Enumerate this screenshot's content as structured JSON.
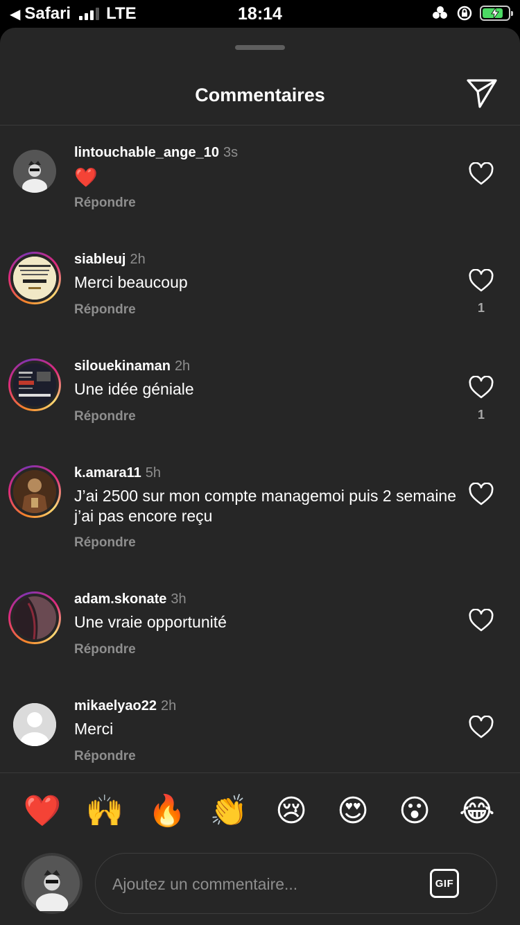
{
  "status_bar": {
    "back_app": "Safari",
    "carrier": "LTE",
    "time": "18:14",
    "battery_level": 0.8
  },
  "header": {
    "title": "Commentaires",
    "share_icon": "paper-plane-icon"
  },
  "reply_label": "Répondre",
  "comments": [
    {
      "username": "lintouchable_ange_10",
      "time": "3s",
      "text": "❤️",
      "likes": "",
      "story_ring": false
    },
    {
      "username": "siableuj",
      "time": "2h",
      "text": "Merci beaucoup",
      "likes": "1",
      "story_ring": true
    },
    {
      "username": "silouekinaman",
      "time": "2h",
      "text": "Une idée géniale",
      "likes": "1",
      "story_ring": true
    },
    {
      "username": "k.amara11",
      "time": "5h",
      "text": "J’ai 2500 sur mon compte managemoi puis 2 semaine j’ai pas encore reçu",
      "likes": "",
      "story_ring": true
    },
    {
      "username": "adam.skonate",
      "time": "3h",
      "text": "Une vraie opportunité",
      "likes": "",
      "story_ring": true
    },
    {
      "username": "mikaelyao22",
      "time": "2h",
      "text": "Merci",
      "likes": "",
      "story_ring": false
    }
  ],
  "quick_reactions": [
    "❤️",
    "🙌",
    "🔥",
    "👏",
    "😢",
    "😍",
    "😮",
    "😂"
  ],
  "composer": {
    "placeholder": "Ajoutez un commentaire...",
    "gif_label": "GIF"
  },
  "colors": {
    "sheet_bg": "#262626",
    "secondary_text": "#8e8e8e",
    "battery_green": "#4cd964"
  }
}
